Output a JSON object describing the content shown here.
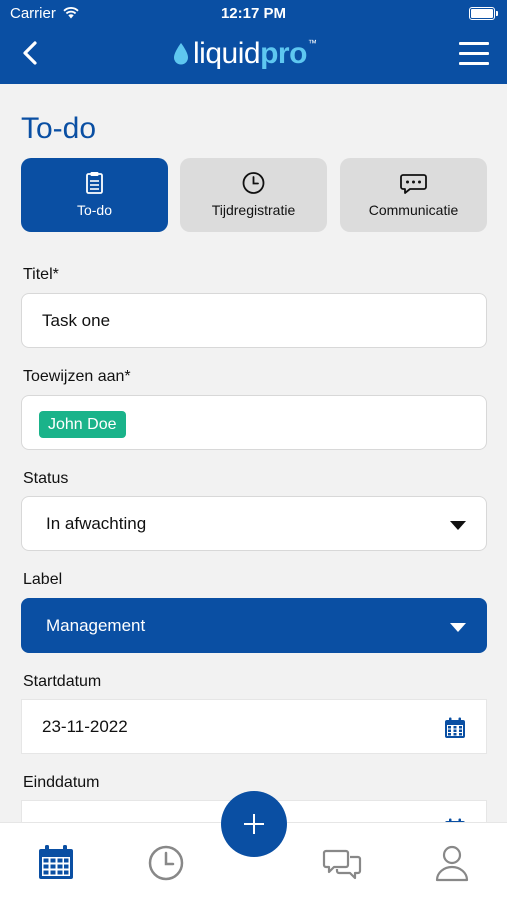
{
  "status_bar": {
    "carrier": "Carrier",
    "time": "12:17 PM"
  },
  "header": {
    "logo_part1": "liquid",
    "logo_part2": "pro",
    "logo_tm": "™"
  },
  "page": {
    "title": "To-do"
  },
  "tabs": [
    {
      "label": "To-do",
      "icon": "clipboard-icon",
      "active": true
    },
    {
      "label": "Tijdregistratie",
      "icon": "clock-icon",
      "active": false
    },
    {
      "label": "Communicatie",
      "icon": "chat-icon",
      "active": false
    }
  ],
  "form": {
    "title": {
      "label": "Titel*",
      "value": "Task one"
    },
    "assign": {
      "label": "Toewijzen aan*",
      "chip": "John Doe"
    },
    "status": {
      "label": "Status",
      "value": "In afwachting"
    },
    "tag": {
      "label": "Label",
      "value": "Management"
    },
    "start": {
      "label": "Startdatum",
      "value": "23-11-2022"
    },
    "end": {
      "label": "Einddatum",
      "value": ""
    }
  },
  "bottom_nav": [
    "calendar-icon",
    "clock-icon",
    "add-icon",
    "chat-icon",
    "user-icon"
  ],
  "colors": {
    "primary": "#0a4fa3",
    "accent": "#5ec7f0",
    "chip": "#1ab38a",
    "background": "#f2f2f2"
  }
}
